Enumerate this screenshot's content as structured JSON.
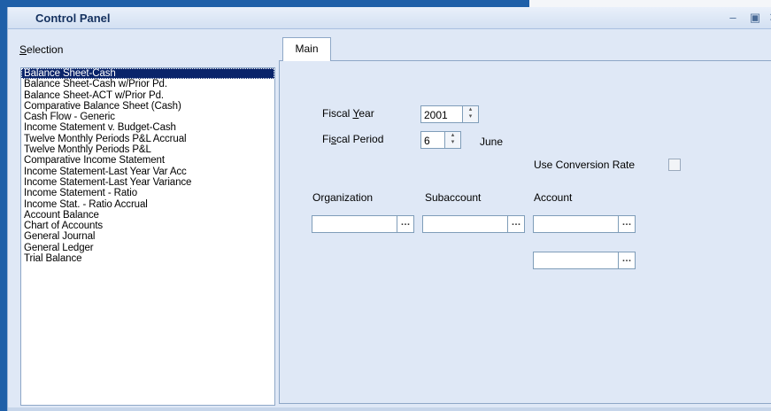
{
  "window": {
    "title": "Control Panel"
  },
  "selection": {
    "label": "Selection",
    "items": [
      "Balance Sheet-Cash",
      "Balance Sheet-Cash w/Prior Pd.",
      "Balance Sheet-ACT w/Prior Pd.",
      "Comparative Balance Sheet (Cash)",
      "Cash Flow - Generic",
      "Income Statement v. Budget-Cash",
      "Twelve Monthly Periods P&L Accrual",
      "Twelve Monthly Periods P&L",
      "Comparative Income Statement",
      "Income Statement-Last Year Var Acc",
      "Income Statement-Last Year Variance",
      "Income Statement - Ratio",
      "Income Stat. - Ratio Accrual",
      "Account Balance",
      "Chart of Accounts",
      "General Journal",
      "General Ledger",
      "Trial Balance"
    ],
    "selected_index": 0
  },
  "tabs": [
    {
      "label": "Main"
    }
  ],
  "main": {
    "fiscal_year": {
      "label": "Fiscal Year",
      "value": "2001"
    },
    "fiscal_period": {
      "label": "Fiscal Period",
      "value": "6",
      "month": "June"
    },
    "use_conversion_rate": {
      "label": "Use Conversion Rate",
      "checked": false
    },
    "columns": {
      "organization": "Organization",
      "subaccount": "Subaccount",
      "account": "Account"
    },
    "organization_value": "",
    "subaccount_value": "",
    "account_value": "",
    "account_value_2": ""
  },
  "colors": {
    "accent": "#1e5fa8",
    "selected_bg": "#0a246a",
    "panel_bg": "#dfe8f6"
  },
  "icons": [
    "minimize-icon",
    "restore-icon",
    "close-icon",
    "spin-up-icon",
    "spin-down-icon",
    "ellipsis-icon"
  ]
}
